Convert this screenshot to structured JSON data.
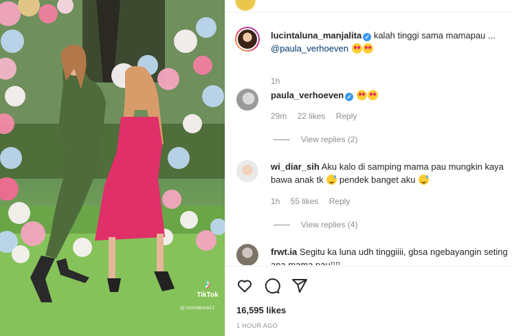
{
  "photo": {
    "watermark_brand": "TikTok",
    "watermark_user": "@ lucintaluna12"
  },
  "comments": [
    {
      "username": "lucintaluna_manjalita",
      "verified": true,
      "text": "kalah tinggi sama mamapau ...",
      "mention": "@paula_verhoeven",
      "emojis": [
        "heart-eyes",
        "heart-eyes"
      ],
      "time": "1h"
    },
    {
      "username": "paula_verhoeven",
      "verified": true,
      "text": "",
      "emojis": [
        "heart-eyes",
        "heart-eyes"
      ],
      "time": "29m",
      "likes": "22 likes",
      "reply_label": "Reply",
      "view_replies": "View replies (2)"
    },
    {
      "username": "wi_diar_sih",
      "verified": false,
      "text": "Aku kalo di samping mama pau mungkin kaya bawa anak tk",
      "text_after_emoji": "pendek banget aku",
      "emojis": [
        "sweat-smile",
        "sweat-smile"
      ],
      "time": "1h",
      "likes": "55 likes",
      "reply_label": "Reply",
      "view_replies": "View replies (4)"
    },
    {
      "username": "frwt.ia",
      "verified": false,
      "text": "Segitu ka luna udh tinggiiii, gbsa ngebayangin seting ana mama pau▯▯"
    }
  ],
  "footer": {
    "likes": "16,595 likes",
    "posted": "1 HOUR AGO",
    "icons": [
      "heart-icon",
      "comment-icon",
      "share-icon"
    ]
  }
}
